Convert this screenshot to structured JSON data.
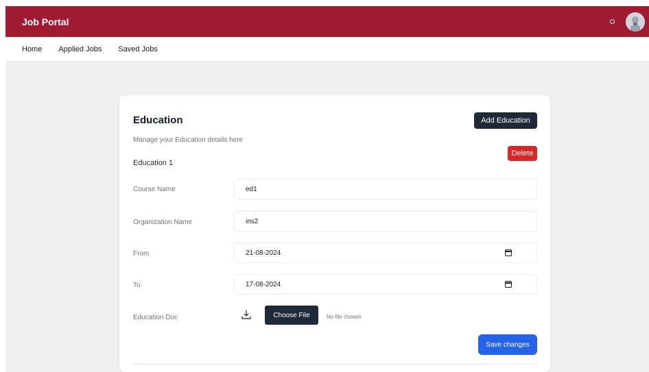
{
  "app": {
    "brand": "Job Portal"
  },
  "nav": {
    "items": [
      {
        "label": "Home"
      },
      {
        "label": "Applied Jobs"
      },
      {
        "label": "Saved Jobs"
      }
    ]
  },
  "education": {
    "title": "Education",
    "description": "Manage your Education details here",
    "add_label": "Add Education",
    "delete_label": "Delete",
    "entry_title": "Education 1",
    "fields": {
      "course_name": {
        "label": "Course Name",
        "value": "ed1"
      },
      "organization_name": {
        "label": "Organization Name",
        "value": "ins2"
      },
      "from": {
        "label": "From",
        "value": "21-08-2024"
      },
      "to": {
        "label": "To",
        "value": "17-08-2024"
      },
      "doc": {
        "label": "Education Doc",
        "choose_label": "Choose File",
        "file_status": "No file chosen"
      }
    },
    "save_label": "Save changes"
  },
  "colors": {
    "brand": "#a01a32",
    "dark_button": "#1f2937",
    "danger": "#dc2626",
    "primary": "#2563eb"
  },
  "icons": {
    "status": "status-dot-icon",
    "avatar": "user-avatar-icon",
    "calendar": "calendar-icon",
    "upload": "upload-icon"
  }
}
